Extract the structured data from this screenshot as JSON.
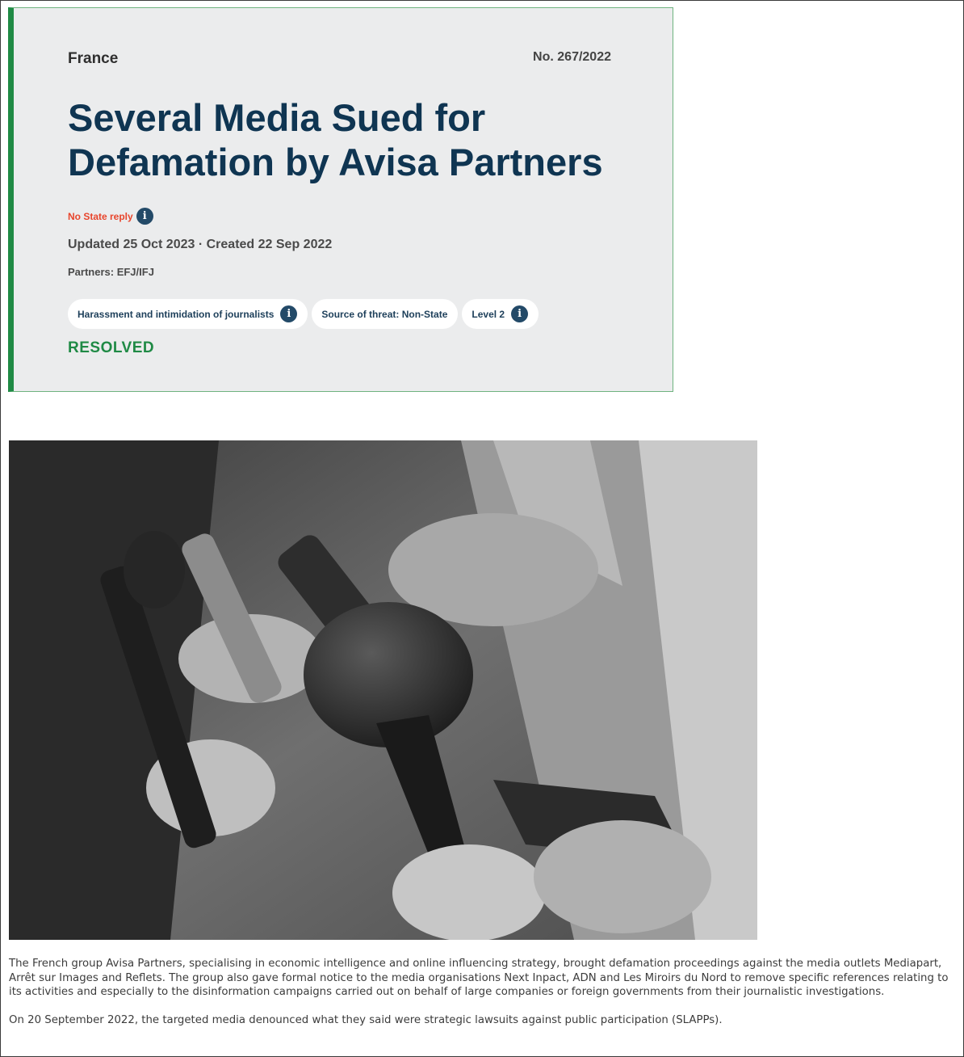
{
  "article": {
    "country": "France",
    "case_number": "No. 267/2022",
    "title": "Several Media Sued for Defamation by Avisa Partners",
    "state_reply": "No State reply",
    "dates": "Updated 25 Oct 2023 · Created 22 Sep 2022",
    "partners": "Partners: EFJ/IFJ",
    "tags": [
      {
        "label": "Harassment and intimidation of journalists",
        "icon": "info-icon"
      },
      {
        "label": "Source of threat: Non-State"
      },
      {
        "label": "Level 2",
        "icon": "info-icon"
      }
    ],
    "status": "RESOLVED"
  },
  "body": {
    "paragraphs": [
      "The French group Avisa Partners, specialising in economic intelligence and online influencing strategy, brought defamation proceedings against the media outlets Mediapart, Arrêt sur Images and Reflets. The group also gave formal notice to the media organisations Next Inpact, ADN and Les Miroirs du Nord to remove specific references relating to its activities and especially to the disinformation campaigns carried out on behalf of large companies or foreign governments from their journalistic investigations.",
      "On 20 September 2022, the targeted media denounced what they said were strategic lawsuits against public participation (SLAPPs)."
    ]
  },
  "colors": {
    "accent_green": "#1f8a45",
    "title_navy": "#0f3552",
    "warning_red": "#e8452c",
    "card_bg": "#ebeced"
  }
}
